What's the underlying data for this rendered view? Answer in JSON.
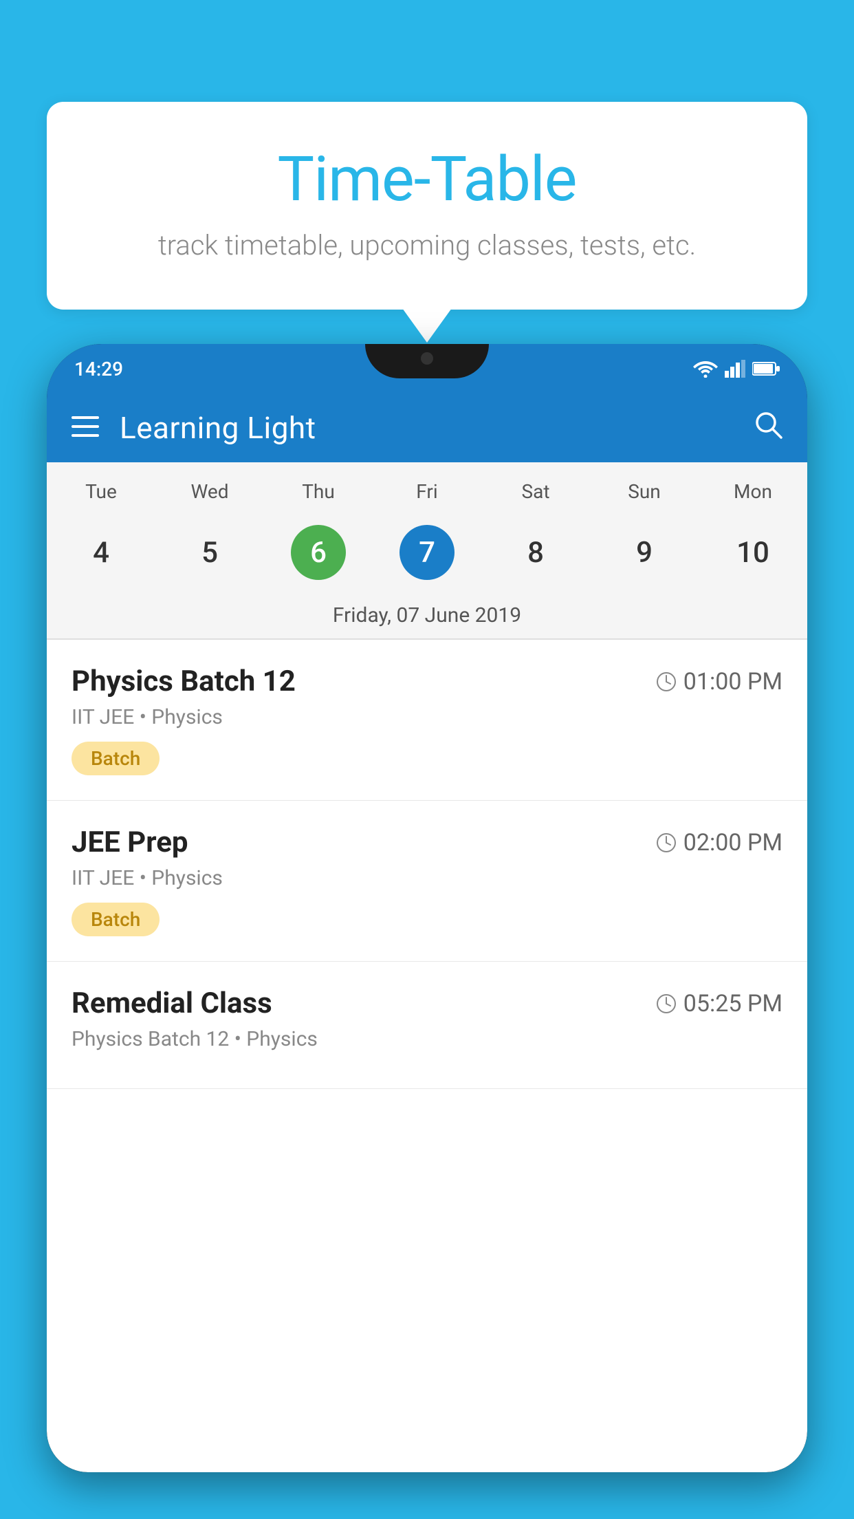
{
  "background_color": "#29b6e8",
  "bubble": {
    "title": "Time-Table",
    "subtitle": "track timetable, upcoming classes, tests, etc."
  },
  "phone": {
    "status": {
      "time": "14:29"
    },
    "app_bar": {
      "title": "Learning Light",
      "menu_icon": "menu-icon",
      "search_icon": "search-icon"
    },
    "calendar": {
      "days": [
        "Tue",
        "Wed",
        "Thu",
        "Fri",
        "Sat",
        "Sun",
        "Mon"
      ],
      "dates": [
        {
          "num": "4",
          "state": "normal"
        },
        {
          "num": "5",
          "state": "normal"
        },
        {
          "num": "6",
          "state": "today"
        },
        {
          "num": "7",
          "state": "selected"
        },
        {
          "num": "8",
          "state": "normal"
        },
        {
          "num": "9",
          "state": "normal"
        },
        {
          "num": "10",
          "state": "normal"
        }
      ],
      "selected_date_label": "Friday, 07 June 2019"
    },
    "schedule": [
      {
        "title": "Physics Batch 12",
        "time": "01:00 PM",
        "subtitle": "IIT JEE • Physics",
        "badge": "Batch"
      },
      {
        "title": "JEE Prep",
        "time": "02:00 PM",
        "subtitle": "IIT JEE • Physics",
        "badge": "Batch"
      },
      {
        "title": "Remedial Class",
        "time": "05:25 PM",
        "subtitle": "Physics Batch 12 • Physics",
        "badge": ""
      }
    ]
  }
}
